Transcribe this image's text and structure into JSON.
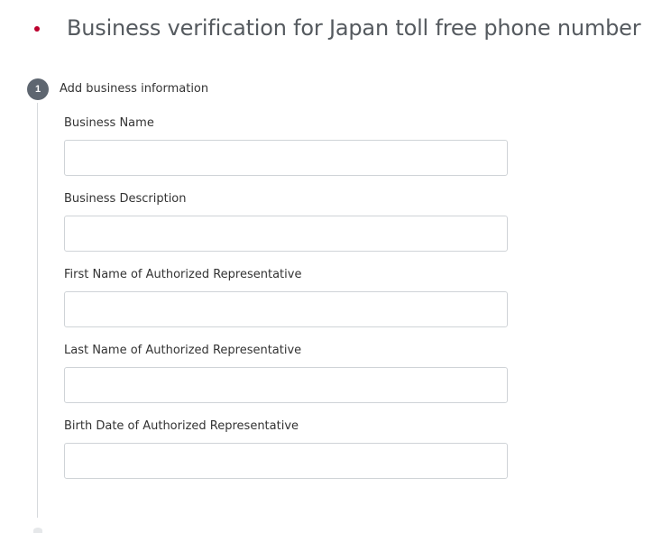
{
  "header": {
    "flag_icon": "japan-flag-icon",
    "title": "Business verification for Japan toll free phone number"
  },
  "colors": {
    "flag_red": "#bc002d",
    "badge": "#5e6670",
    "input_border": "#cfd3d7",
    "step_line": "#d6d9dc"
  },
  "step": {
    "number": "1",
    "label": "Add business information"
  },
  "fields": [
    {
      "label": "Business Name",
      "value": "",
      "placeholder": ""
    },
    {
      "label": "Business Description",
      "value": "",
      "placeholder": ""
    },
    {
      "label": "First Name of Authorized Representative",
      "value": "",
      "placeholder": ""
    },
    {
      "label": "Last Name of Authorized Representative",
      "value": "",
      "placeholder": ""
    },
    {
      "label": "Birth Date of Authorized Representative",
      "value": "",
      "placeholder": ""
    }
  ]
}
